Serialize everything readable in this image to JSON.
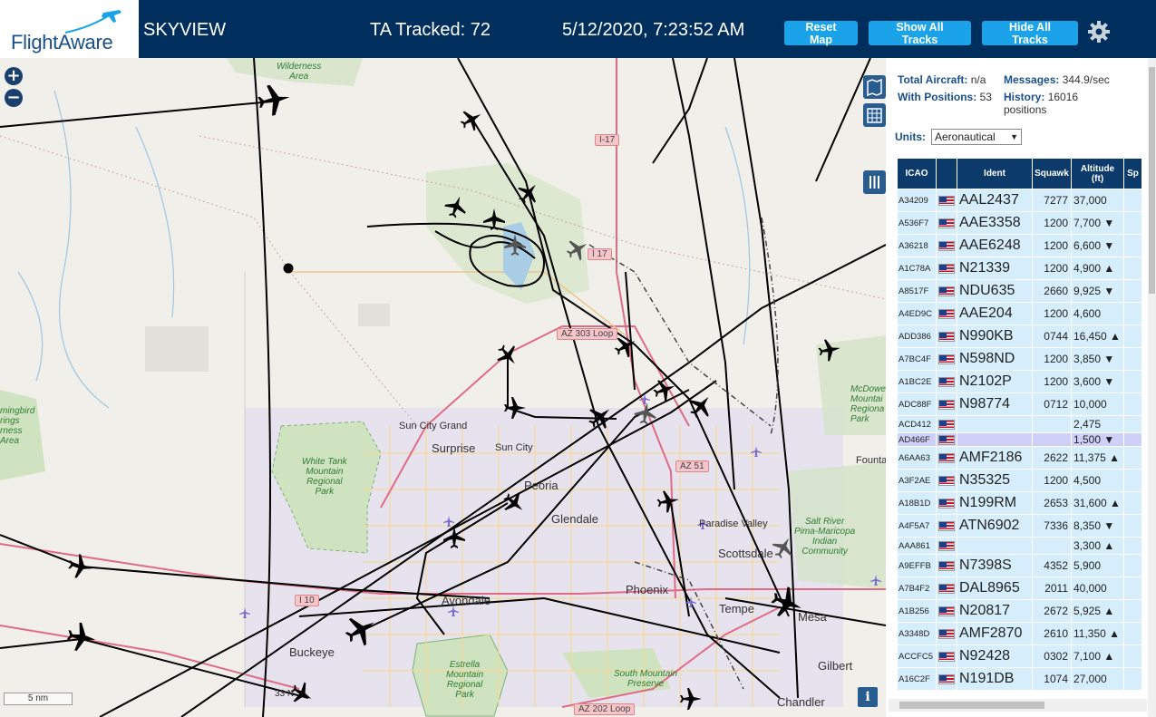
{
  "header": {
    "brand": "FlightAware",
    "app_title": "SKYVIEW",
    "tracked": "TA Tracked: 72",
    "datetime": "5/12/2020, 7:23:52 AM",
    "buttons": {
      "reset": "Reset Map",
      "show": "Show All Tracks",
      "hide": "Hide All Tracks"
    }
  },
  "map": {
    "zoom_in": "+",
    "zoom_out": "−",
    "scale": "5 nm",
    "labels": {
      "surprise": "Surprise",
      "sun_city": "Sun City",
      "sun_city_grand": "Sun City Grand",
      "peoria": "Peoria",
      "glendale": "Glendale",
      "phoenix": "Phoenix",
      "avondale": "Avondale",
      "buckeye": "Buckeye",
      "tempe": "Tempe",
      "mesa": "Mesa",
      "gilbert": "Gilbert",
      "chandler": "Chandler",
      "scottsdale": "Scottsdale",
      "paradise_valley": "Paradise Valley",
      "fountain": "Founta"
    },
    "green_labels": {
      "wilderness": "Wilderness\nArea",
      "white_tank": "White Tank\nMountain\nRegional\nPark",
      "estrella": "Estrella\nMountain\nRegional\nPark",
      "south_mountain": "South Mountain\nPreserve",
      "salt_river": "Salt River\nPima-Maricopa\nIndian\nCommunity",
      "mcdowell": "McDowel\nMountai\nRegiona\nPark",
      "hummingbird": "mingbird\nrings\nrness\nArea"
    },
    "highways": {
      "i17": "I-17",
      "i17b": "I 17",
      "az303": "AZ 303 Loop",
      "az51": "AZ 51",
      "i10": "I 10",
      "az202": "AZ 202 Loop",
      "r33": "33 N"
    },
    "info": "i"
  },
  "panel": {
    "total_label": "Total Aircraft:",
    "total_value": "n/a",
    "messages_label": "Messages:",
    "messages_value": "344.9/sec",
    "withpos_label": "With Positions:",
    "withpos_value": "53",
    "history_label": "History:",
    "history_value": "16016 positions",
    "units_label": "Units:",
    "units_value": "Aeronautical"
  },
  "table": {
    "headers": [
      "ICAO",
      "",
      "Ident",
      "Squawk",
      "Altitude (ft)",
      "Sp"
    ],
    "rows": [
      {
        "icao": "A34209",
        "ident": "AAL2437",
        "squawk": "7277",
        "alt": "37,000"
      },
      {
        "icao": "A536F7",
        "ident": "AAE3358",
        "squawk": "1200",
        "alt": "7,700 ▼"
      },
      {
        "icao": "A36218",
        "ident": "AAE6248",
        "squawk": "1200",
        "alt": "6,600 ▼"
      },
      {
        "icao": "A1C78A",
        "ident": "N21339",
        "squawk": "1200",
        "alt": "4,900 ▲"
      },
      {
        "icao": "A8517F",
        "ident": "NDU635",
        "squawk": "2660",
        "alt": "9,925 ▼"
      },
      {
        "icao": "A4ED9C",
        "ident": "AAE204",
        "squawk": "1200",
        "alt": "4,600"
      },
      {
        "icao": "ADD386",
        "ident": "N990KB",
        "squawk": "0744",
        "alt": "16,450 ▲"
      },
      {
        "icao": "A7BC4F",
        "ident": "N598ND",
        "squawk": "1200",
        "alt": "3,850 ▼"
      },
      {
        "icao": "A1BC2E",
        "ident": "N2102P",
        "squawk": "1200",
        "alt": "3,600 ▼"
      },
      {
        "icao": "ADC88F",
        "ident": "N98774",
        "squawk": "0712",
        "alt": "10,000"
      },
      {
        "icao": "ACD412",
        "ident": "",
        "squawk": "",
        "alt": "2,475"
      },
      {
        "icao": "AD466F",
        "ident": "",
        "squawk": "",
        "alt": "1,500 ▼"
      },
      {
        "icao": "A6AA63",
        "ident": "AMF2186",
        "squawk": "2622",
        "alt": "11,375 ▲"
      },
      {
        "icao": "A3F2AE",
        "ident": "N35325",
        "squawk": "1200",
        "alt": "4,500"
      },
      {
        "icao": "A18B1D",
        "ident": "N199RM",
        "squawk": "2653",
        "alt": "31,600 ▲"
      },
      {
        "icao": "A4F5A7",
        "ident": "ATN6902",
        "squawk": "7336",
        "alt": "8,350 ▼"
      },
      {
        "icao": "AAA861",
        "ident": "",
        "squawk": "",
        "alt": "3,300 ▲"
      },
      {
        "icao": "A9EFFB",
        "ident": "N7398S",
        "squawk": "4352",
        "alt": "5,900"
      },
      {
        "icao": "A7B4F2",
        "ident": "DAL8965",
        "squawk": "2011",
        "alt": "40,000"
      },
      {
        "icao": "A1B256",
        "ident": "N20817",
        "squawk": "2672",
        "alt": "5,925 ▲"
      },
      {
        "icao": "A3348D",
        "ident": "AMF2870",
        "squawk": "2610",
        "alt": "11,350 ▲"
      },
      {
        "icao": "ACCFC5",
        "ident": "N92428",
        "squawk": "0302",
        "alt": "7,100 ▲"
      },
      {
        "icao": "A16C2F",
        "ident": "N191DB",
        "squawk": "1074",
        "alt": "27,000"
      }
    ]
  },
  "colors": {
    "header_bg": "#002f5d",
    "button": "#1aa3e8",
    "table_header": "#0c3b6b",
    "row": "#d6eefc",
    "row_selected": "#cfd0f7"
  }
}
